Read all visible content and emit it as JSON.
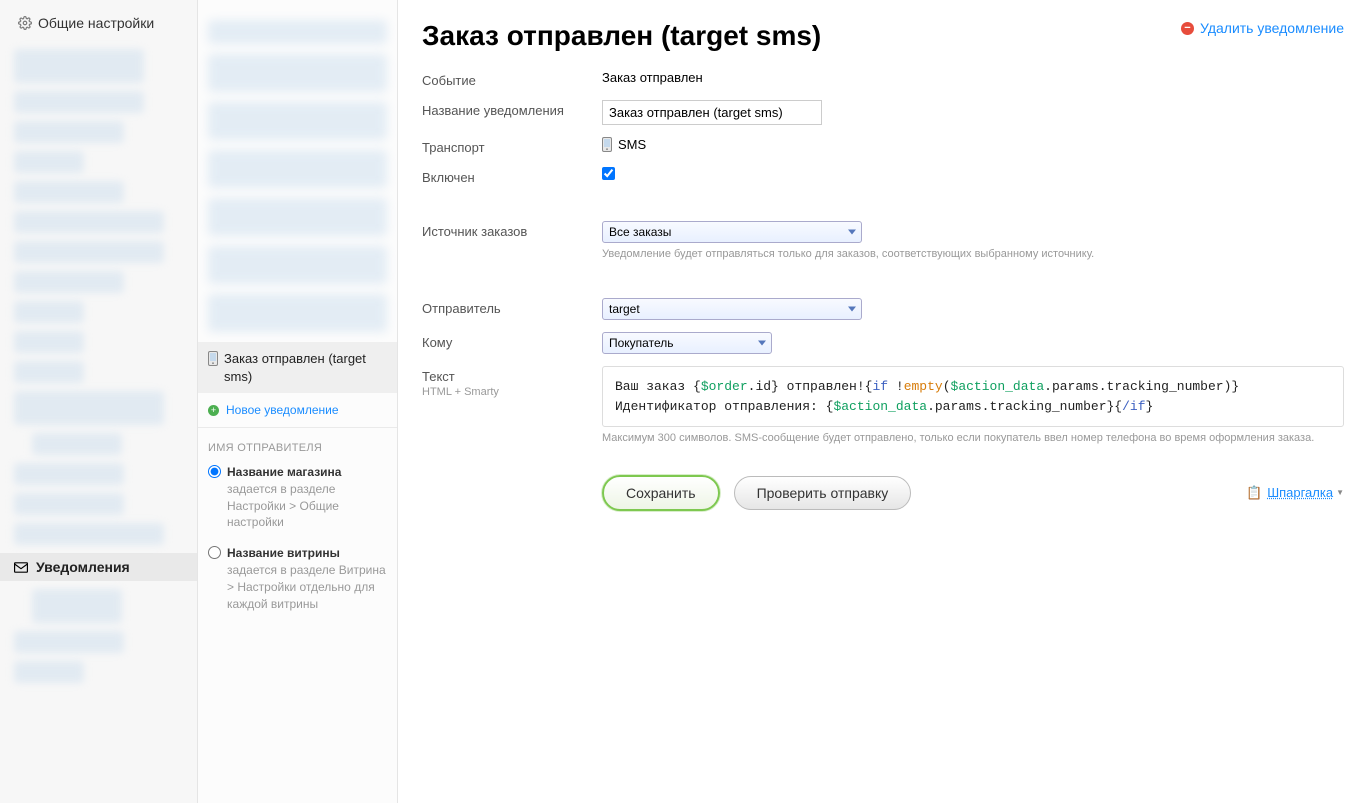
{
  "leftSidebar": {
    "header": "Общие настройки",
    "activeNav": "Уведомления"
  },
  "middle": {
    "activeItem": "Заказ отправлен (target sms)",
    "addNew": "Новое уведомление",
    "senderNameSection": "ИМЯ ОТПРАВИТЕЛЯ",
    "radio1_bold": "Название магазина",
    "radio1_rest": " задается в разделе Настройки > Общие настройки",
    "radio2_bold": "Название витрины",
    "radio2_rest": " задается в разделе Витрина > Настройки отдельно для каждой витрины"
  },
  "page": {
    "title": "Заказ отправлен (target sms)",
    "deleteLink": "Удалить уведомление",
    "labels": {
      "event": "Событие",
      "name": "Название уведомления",
      "transport": "Транспорт",
      "enabled": "Включен",
      "source": "Источник заказов",
      "sender": "Отправитель",
      "recipient": "Кому",
      "text": "Текст",
      "textSub": "HTML + Smarty"
    },
    "values": {
      "event": "Заказ отправлен",
      "name": "Заказ отправлен (target sms)",
      "transport": "SMS",
      "source": "Все заказы",
      "sourceHint": "Уведомление будет отправляться только для заказов, соответствующих выбранному источнику.",
      "sender": "target",
      "recipient": "Покупатель",
      "textHint": "Максимум 300 символов. SMS-сообщение будет отправлено, только если покупатель ввел номер телефона во время оформления заказа."
    },
    "code": {
      "p1": "Ваш заказ {",
      "p2": "$order",
      "p3": ".id} отправлен!{",
      "p4": "if",
      "p5": " !",
      "p6": "empty",
      "p7": "(",
      "p8": "$action_data",
      "p9": ".params.tracking_number)} Идентификатор отправления: {",
      "p10": "$action_data",
      "p11": ".params.tracking_number}{",
      "p12": "/if",
      "p13": "}"
    },
    "buttons": {
      "save": "Сохранить",
      "test": "Проверить отправку"
    },
    "cheatsheet": "Шпаргалка"
  }
}
